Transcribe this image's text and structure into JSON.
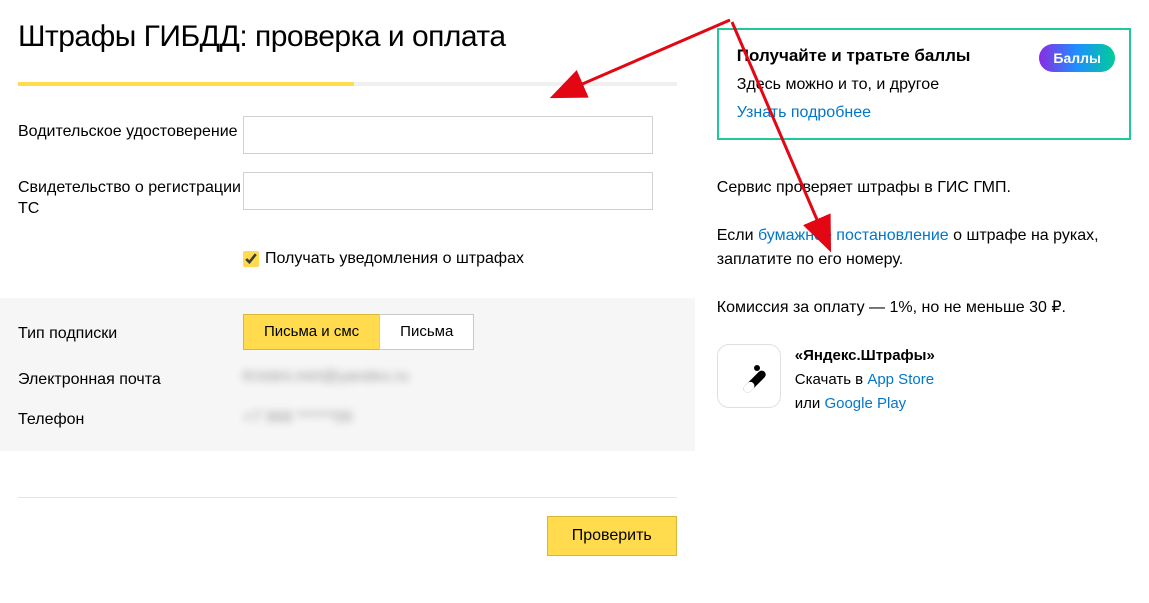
{
  "page": {
    "title": "Штрафы ГИБДД: проверка и оплата"
  },
  "form": {
    "driver_license_label": "Водительское удостоверение",
    "registration_label": "Свидетельство о регистрации ТС",
    "notify_checkbox_label": "Получать уведомления о штрафах",
    "subscription_type_label": "Тип подписки",
    "seg_both": "Письма и смс",
    "seg_letters": "Письма",
    "email_label": "Электронная почта",
    "email_value": "Kristini.mirt@yandex.ru",
    "phone_label": "Телефон",
    "phone_value": "+7 968 ******09",
    "submit_label": "Проверить"
  },
  "promo": {
    "title": "Получайте и тратьте баллы",
    "badge": "Баллы",
    "sub": "Здесь можно и то, и другое",
    "more": "Узнать подробнее"
  },
  "info": {
    "line1": "Сервис проверяет штрафы в ГИС ГМП.",
    "line2_pre": "Если ",
    "line2_link": "бумажное постановление",
    "line2_post": " о штрафе на руках, заплатите по его номеру.",
    "line3": "Комиссия за оплату — 1%, но не меньше 30 ₽."
  },
  "app": {
    "title": "«Яндекс.Штрафы»",
    "download_pre": "Скачать в ",
    "appstore": "App Store",
    "or": "или ",
    "googleplay": "Google Play"
  }
}
